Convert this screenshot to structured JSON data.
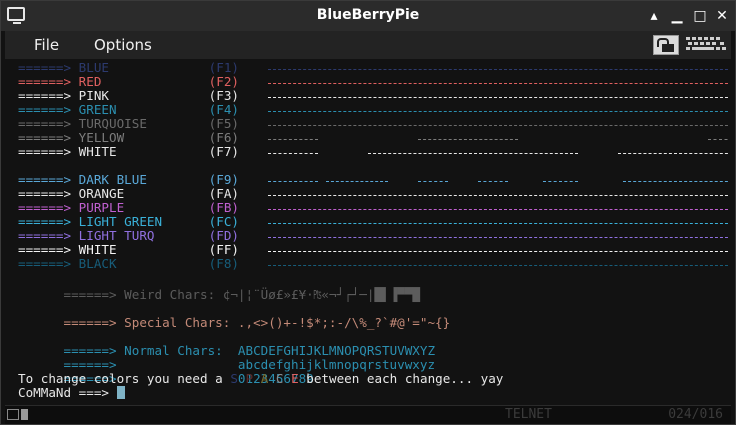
{
  "window": {
    "title": "BlueBerryPie"
  },
  "menu": {
    "file": "File",
    "options": "Options"
  },
  "terminal": {
    "color_rows": [
      {
        "arrow": "======>",
        "name": "BLUE",
        "key": "(F1)",
        "color": "#2c3a6e"
      },
      {
        "arrow": "======>",
        "name": "RED",
        "key": "(F2)",
        "color": "#e06060"
      },
      {
        "arrow": "======>",
        "name": "PINK",
        "key": "(F3)",
        "color": "#e8e8e8"
      },
      {
        "arrow": "======>",
        "name": "GREEN",
        "key": "(F4)",
        "color": "#2b8fb0"
      },
      {
        "arrow": "======>",
        "name": "TURQUOISE",
        "key": "(F5)",
        "color": "#6a6a6a"
      },
      {
        "arrow": "======>",
        "name": "YELLOW",
        "key": "(F6)",
        "color": "#7d7d7d"
      },
      {
        "arrow": "======>",
        "name": "WHITE",
        "key": "(F7)",
        "color": "#e8e8e8"
      },
      {
        "arrow": "======>",
        "name": "DARK BLUE",
        "key": "(F9)",
        "color": "#5aa8d8"
      },
      {
        "arrow": "======>",
        "name": "ORANGE",
        "key": "(FA)",
        "color": "#e8e8e8"
      },
      {
        "arrow": "======>",
        "name": "PURPLE",
        "key": "(FB)",
        "color": "#c060d0"
      },
      {
        "arrow": "======>",
        "name": "LIGHT GREEN",
        "key": "(FC)",
        "color": "#3ab0d8"
      },
      {
        "arrow": "======>",
        "name": "LIGHT TURQ",
        "key": "(FD)",
        "color": "#9070e0"
      },
      {
        "arrow": "======>",
        "name": "WHITE",
        "key": "(FF)",
        "color": "#f5f5f5"
      },
      {
        "arrow": "======>",
        "name": "BLACK",
        "key": "(F8)",
        "color": "#175d7a"
      }
    ],
    "weird": {
      "arrow": "======>",
      "label": "Weird Chars:",
      "chars": "¢¬|¦¨Üø£»£¥·₧«¬┘┌┘─|█▌▐▀▀█",
      "color": "#5c5c5c"
    },
    "special": {
      "arrow": "======>",
      "label": "Special Chars:",
      "chars": ".,<>()+-!$*;:-/\\%_?`#@'=\"~{}",
      "color": "#c48a78"
    },
    "normal": {
      "arrow": "======>",
      "label": "Normal Chars:",
      "upper": "ABCDEFGHIJKLMNOPQRSTUVWXYZ",
      "lower": "abcdefghijklmnopqrstuvwxyz",
      "digits": "0123456789",
      "color": "#2b8fb0"
    },
    "instruction": {
      "text": "To change colors you need a",
      "after": "between each change... yay",
      "letters": [
        "S",
        "P",
        "A",
        "C",
        "E"
      ]
    },
    "prompt": {
      "label": "CoMMaNd ===>"
    }
  },
  "status": {
    "mode": "TELNET",
    "position": "024/016"
  }
}
